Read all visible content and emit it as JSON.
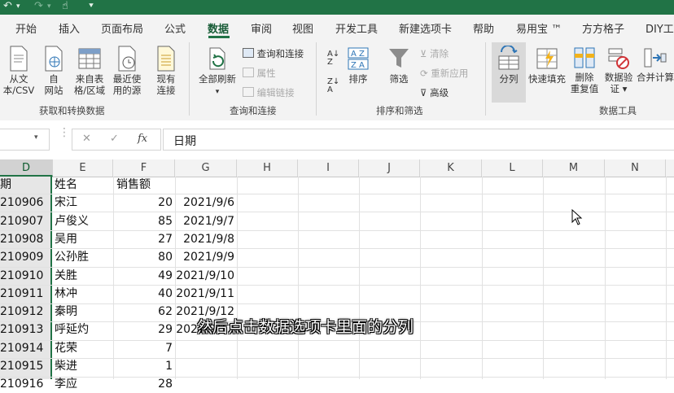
{
  "ribbon_tabs": [
    "开始",
    "插入",
    "页面布局",
    "公式",
    "数据",
    "审阅",
    "视图",
    "开发工具",
    "新建选项卡",
    "帮助",
    "易用宝 ™",
    "方方格子",
    "DIY工"
  ],
  "active_tab": "数据",
  "groups": {
    "get_transform": {
      "label": "获取和转换数据",
      "from_csv": [
        "从文",
        "本/CSV"
      ],
      "from_web": [
        "自",
        "网站"
      ],
      "from_table": [
        "来自表",
        "格/区域"
      ],
      "recent_sources": [
        "最近使",
        "用的源"
      ],
      "existing_conn": [
        "现有",
        "连接"
      ]
    },
    "queries": {
      "label": "查询和连接",
      "refresh_all": [
        "全部刷新"
      ],
      "queries_conn": "查询和连接",
      "properties": "属性",
      "edit_links": "编辑链接"
    },
    "sort_filter": {
      "label": "排序和筛选",
      "sort": "排序",
      "filter": "筛选",
      "clear": "清除",
      "reapply": "重新应用",
      "advanced": "高级"
    },
    "data_tools": {
      "label": "数据工具",
      "text_to_columns": "分列",
      "flash_fill": "快速填充",
      "remove_dup": [
        "删除",
        "重复值"
      ],
      "validation": [
        "数据验",
        "证 ▾"
      ],
      "consolidate": "合并计算"
    }
  },
  "formula_bar": {
    "cancel": "✕",
    "enter": "✓",
    "fx": "fx",
    "value": "日期"
  },
  "columns": [
    "D",
    "E",
    "F",
    "G",
    "H",
    "I",
    "J",
    "K",
    "L",
    "M",
    "N"
  ],
  "rows": [
    {
      "d": "期",
      "e": "姓名",
      "f": "销售额",
      "g": ""
    },
    {
      "d": "210906",
      "e": "宋江",
      "f": "20",
      "g": "2021/9/6"
    },
    {
      "d": "210907",
      "e": "卢俊义",
      "f": "85",
      "g": "2021/9/7"
    },
    {
      "d": "210908",
      "e": "吴用",
      "f": "27",
      "g": "2021/9/8"
    },
    {
      "d": "210909",
      "e": "公孙胜",
      "f": "80",
      "g": "2021/9/9"
    },
    {
      "d": "210910",
      "e": "关胜",
      "f": "49",
      "g": "2021/9/10"
    },
    {
      "d": "210911",
      "e": "林冲",
      "f": "40",
      "g": "2021/9/11"
    },
    {
      "d": "210912",
      "e": "秦明",
      "f": "62",
      "g": "2021/9/12"
    },
    {
      "d": "210913",
      "e": "呼延灼",
      "f": "29",
      "g": "2021/9/13"
    },
    {
      "d": "210914",
      "e": "花荣",
      "f": "7",
      "g": ""
    },
    {
      "d": "210915",
      "e": "柴进",
      "f": "1",
      "g": ""
    },
    {
      "d": "210916",
      "e": "李应",
      "f": "28",
      "g": ""
    }
  ],
  "subtitle": "然后点击数据选项卡里面的分列",
  "colors": {
    "accent": "#217346",
    "ribbon_bg": "#f3f3f3",
    "grid": "#e1e1e1"
  }
}
